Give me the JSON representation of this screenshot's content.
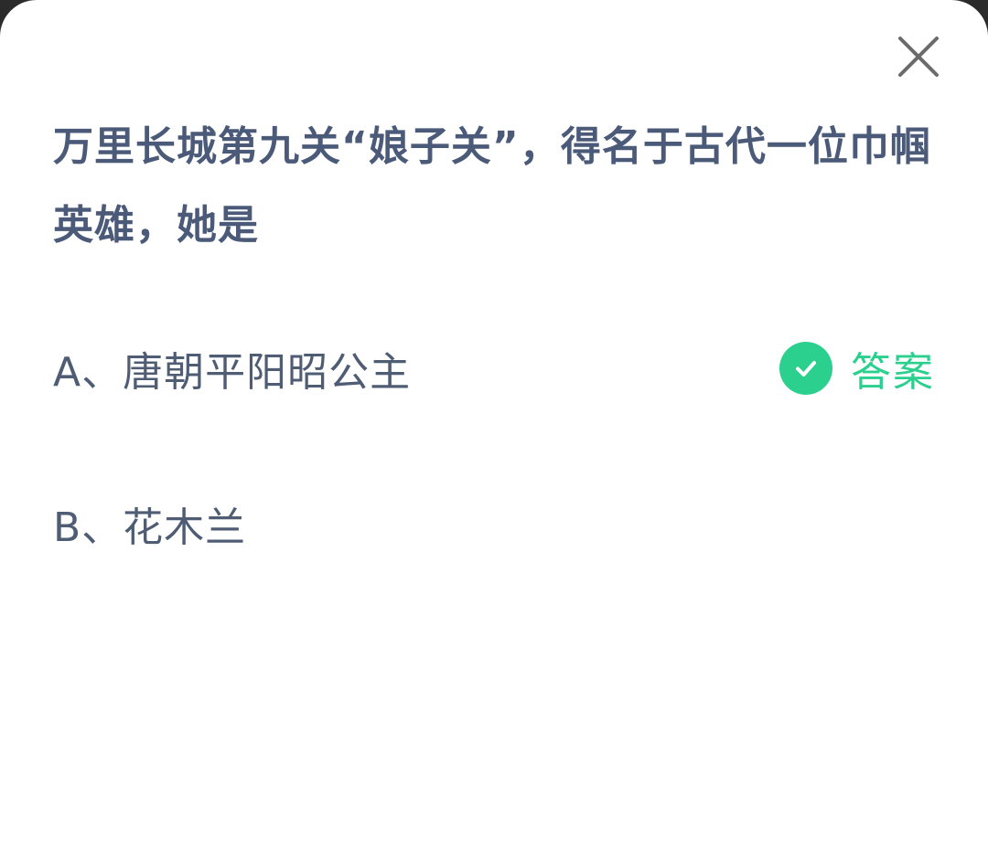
{
  "question": {
    "text": "万里长城第九关“娘子关”，得名于古代一位巾帼英雄，她是"
  },
  "options": [
    {
      "label": "A、唐朝平阳昭公主",
      "is_answer": true
    },
    {
      "label": "B、花木兰",
      "is_answer": false
    }
  ],
  "answer_tag": {
    "label": "答案",
    "icon": "check-circle-icon",
    "color": "#2bd08e"
  },
  "close_icon": "close-icon",
  "colors": {
    "question_text": "#4a5a78",
    "option_text": "#4e5c74",
    "close_icon": "#6b6b6b"
  }
}
